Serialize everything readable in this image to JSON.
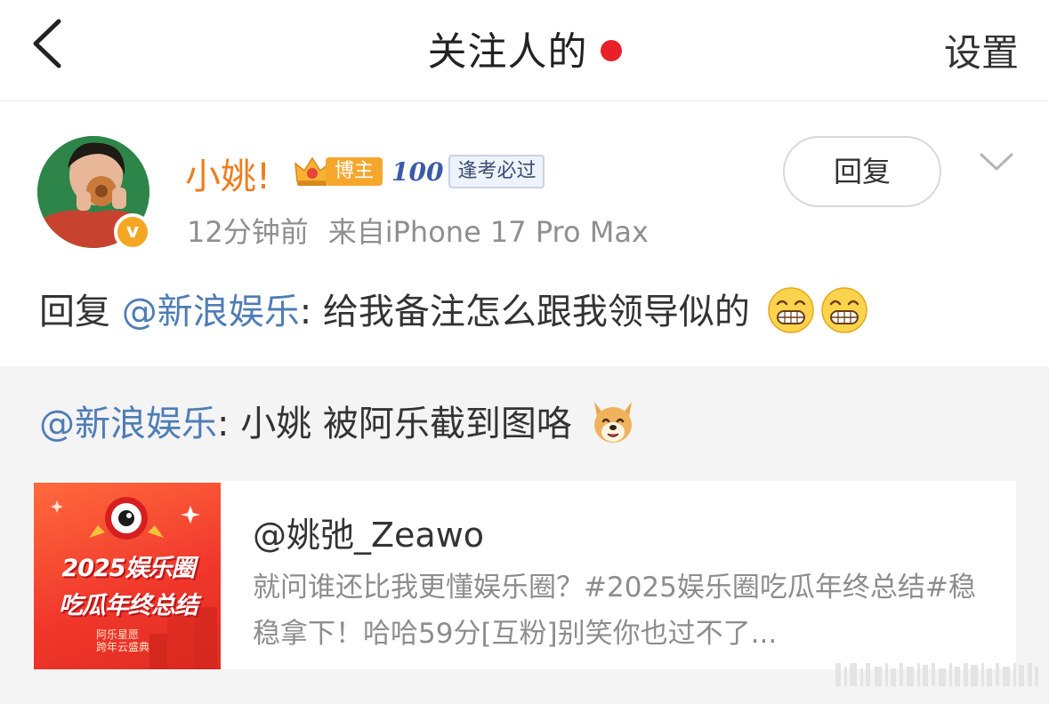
{
  "nav": {
    "back_icon": "chevron-left-icon",
    "title": "关注人的",
    "settings_label": "设置",
    "dot_color": "#e8202a"
  },
  "post": {
    "username": "小姚!",
    "badge_label": "博主",
    "exam_badge_number": "100",
    "exam_badge_label": "逢考必过",
    "verified_icon": "v",
    "reply_button_label": "回复",
    "time": "12分钟前",
    "source": "来自iPhone 17 Pro Max",
    "text_prefix": "回复 ",
    "mention": "@新浪娱乐",
    "text_body": ": 给我备注怎么跟我领导似的",
    "emojis": [
      "grin-emoji",
      "grin-emoji"
    ]
  },
  "repost": {
    "mention": "@新浪娱乐",
    "text_body": ": 小姚 被阿乐截到图咯",
    "emoji": "dog-emoji",
    "card": {
      "thumb_line1": "2025娱乐圈",
      "thumb_line2": "吃瓜年终总结",
      "thumb_line3a": "阿乐星愿",
      "thumb_line3b": "跨年云盛典",
      "title": "@姚弛_Zeawo",
      "desc": "就问谁还比我更懂娱乐圈？#2025娱乐圈吃瓜年终总结#稳稳拿下！哈哈59分[互粉]别笑你也过不了..."
    }
  },
  "colors": {
    "username": "#ef7d1e",
    "mention": "#4f7db5",
    "badge": "#f5a72c",
    "verified": "#f5a623"
  }
}
